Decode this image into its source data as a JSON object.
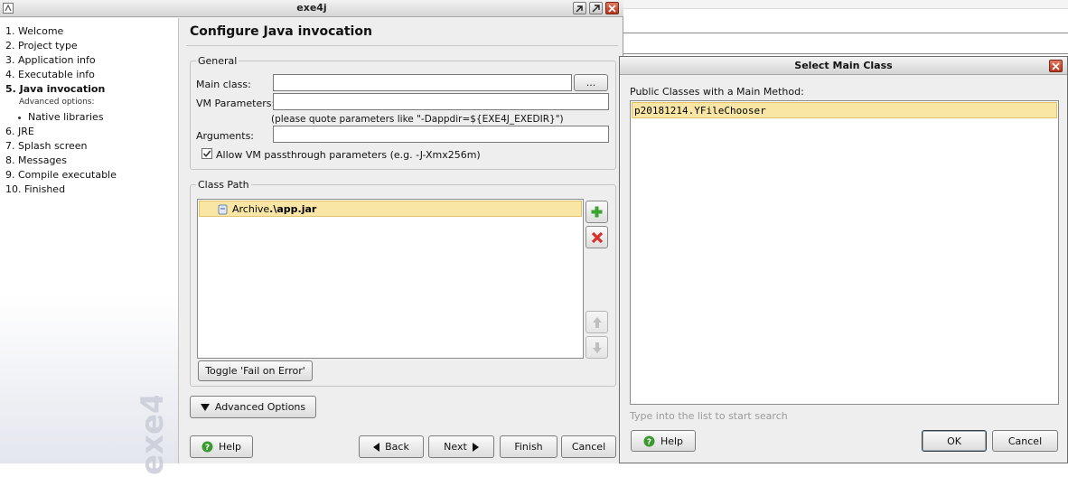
{
  "window": {
    "title": "exe4j"
  },
  "steps": [
    {
      "label": "1. Welcome"
    },
    {
      "label": "2. Project type"
    },
    {
      "label": "3. Application info"
    },
    {
      "label": "4. Executable info"
    },
    {
      "label": "5. Java invocation",
      "active": true
    },
    {
      "label": "6. JRE"
    },
    {
      "label": "7. Splash screen"
    },
    {
      "label": "8. Messages"
    },
    {
      "label": "9. Compile executable"
    },
    {
      "label": "10. Finished"
    }
  ],
  "substeps": {
    "label": "Advanced options:",
    "items": [
      "Native libraries"
    ]
  },
  "watermark": "exe4j",
  "page": {
    "title": "Configure Java invocation"
  },
  "general": {
    "legend": "General",
    "main_class_label": "Main class:",
    "main_class_value": "",
    "browse_label": "...",
    "vm_params_label": "VM Parameters:",
    "vm_params_value": "",
    "vm_hint": "(please quote parameters like \"-Dappdir=${EXE4J_EXEDIR}\")",
    "arguments_label": "Arguments:",
    "arguments_value": "",
    "passthrough_label": "Allow VM passthrough parameters (e.g. -J-Xmx256m)",
    "passthrough_checked": true
  },
  "classpath": {
    "legend": "Class Path",
    "entries": [
      {
        "prefix": "Archive ",
        "value": ".\\app.jar"
      }
    ],
    "toggle_label": "Toggle 'Fail on Error'"
  },
  "advanced_options_label": "Advanced Options",
  "footer": {
    "help": "Help",
    "back": "Back",
    "next": "Next",
    "finish": "Finish",
    "cancel": "Cancel"
  },
  "dialog": {
    "title": "Select Main Class",
    "list_label": "Public Classes with a Main Method:",
    "classes": [
      "p20181214.YFileChooser"
    ],
    "search_hint": "Type into the list to start search",
    "help": "Help",
    "ok": "OK",
    "cancel": "Cancel"
  },
  "colors": {
    "selection": "#f9e6a4",
    "add_green": "#3aa52c",
    "remove_red": "#d8302a",
    "help_green": "#3b9a2f"
  }
}
